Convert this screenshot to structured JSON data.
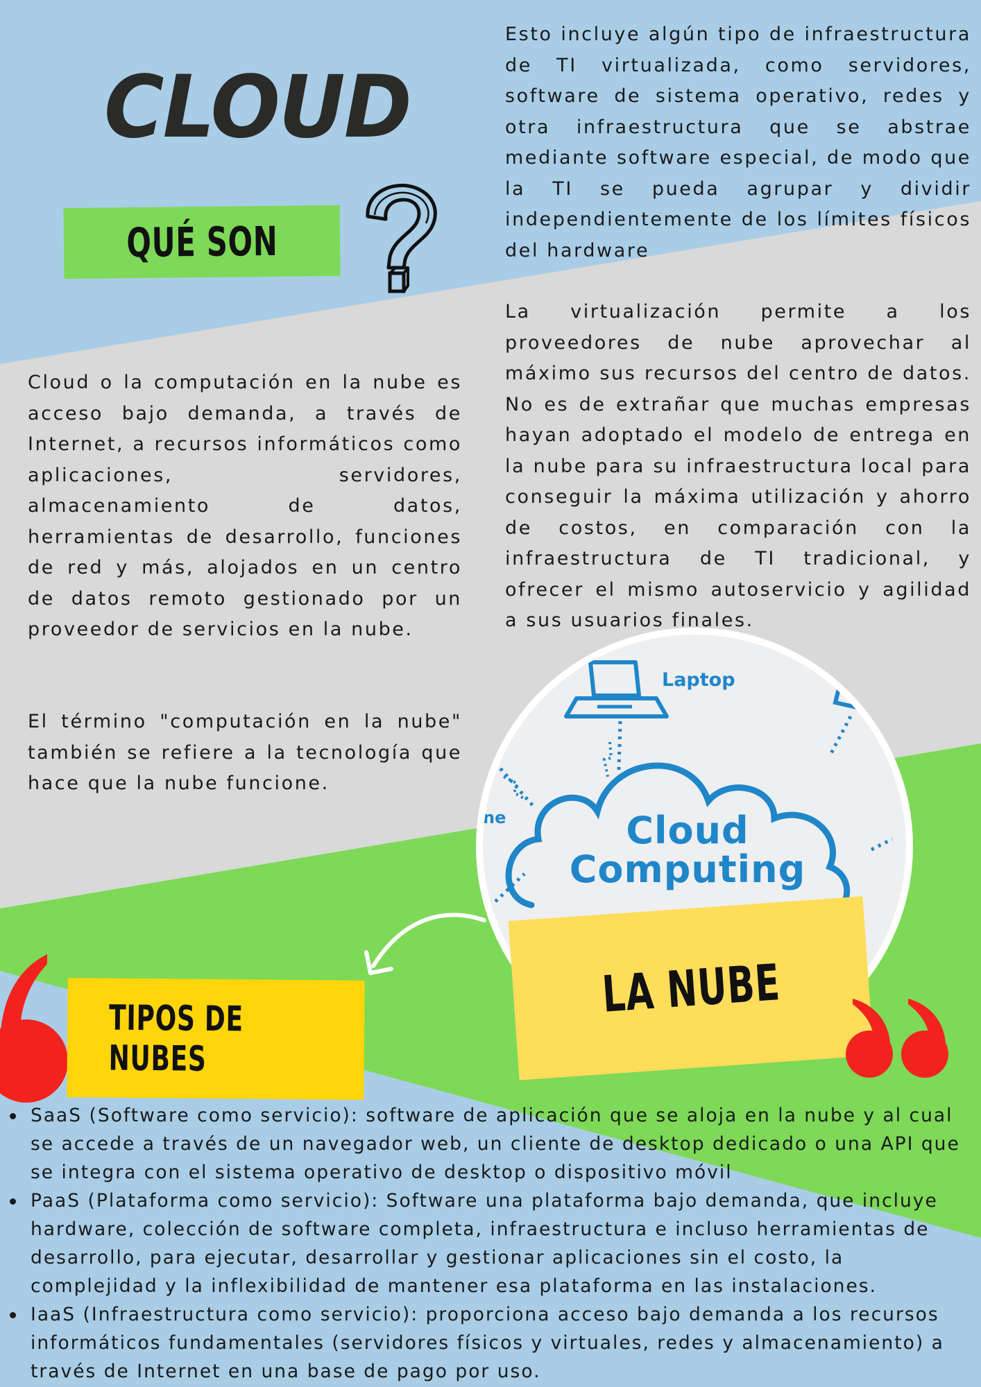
{
  "header": {
    "title": "CLOUD",
    "section_label": "QUÉ SON"
  },
  "intro": {
    "paragraph_1": "Cloud o la computación en la nube es acceso bajo demanda, a través de Internet, a recursos informáticos como aplicaciones, servidores, almacenamiento de datos, herramientas de desarrollo, funciones de red y más, alojados en un centro de datos remoto gestionado por un proveedor de servicios en la nube.",
    "paragraph_2": "El término \"computación en la nube\" también se refiere a la tecnología que hace que la nube funcione."
  },
  "details": {
    "paragraph_1": "Esto incluye algún tipo de infraestructura de TI virtualizada, como servidores, software de sistema operativo, redes y otra infraestructura que se abstrae mediante software especial, de modo que la TI se pueda agrupar y dividir independientemente de los límites físicos del hardware",
    "paragraph_2": "La virtualización permite a los proveedores de nube aprovechar al máximo sus recursos del centro de datos. No es de extrañar que muchas empresas hayan adoptado el modelo de entrega en la nube para su infraestructura local para conseguir la máxima utilización y ahorro de costos, en comparación con la infraestructura de TI tradicional, y ofrecer el mismo autoservicio y agilidad a sus usuarios finales."
  },
  "illustration": {
    "laptop_label": "Laptop",
    "cloud_line_1": "Cloud",
    "cloud_line_2": "Computing",
    "partial_label": "ne",
    "blue": "#1f86c9"
  },
  "labels": {
    "la_nube": "LA NUBE",
    "tipos_de_nubes": "TIPOS DE NUBES"
  },
  "types": [
    "SaaS (Software como servicio): software de aplicación que se aloja en la nube y al cual se accede a través de un navegador web, un cliente de desktop dedicado o una API que se integra con el sistema operativo de desktop o dispositivo móvil",
    "PaaS (Plataforma como servicio): Software una plataforma bajo demanda, que incluye hardware, colección de software completa, infraestructura e incluso herramientas de desarrollo, para ejecutar, desarrollar y gestionar aplicaciones sin el costo, la complejidad y la inflexibilidad de mantener esa plataforma en las instalaciones.",
    "IaaS (Infraestructura como servicio): proporciona acceso bajo demanda a los recursos informáticos fundamentales (servidores físicos y virtuales, redes y almacenamiento) a través de Internet en una base de pago por uso."
  ],
  "colors": {
    "background_blue": "#a9cde6",
    "band_gray": "#d9d9d9",
    "band_green": "#7dd957",
    "label_green": "#7dd957",
    "label_yellow": "#fedd5a",
    "label_gold": "#fed508",
    "quote_red": "#f2231e"
  },
  "icons": [
    "question-mark-icon",
    "curved-arrow-icon",
    "open-quote-icon",
    "close-quote-icon",
    "cloud-icon",
    "laptop-icon"
  ]
}
